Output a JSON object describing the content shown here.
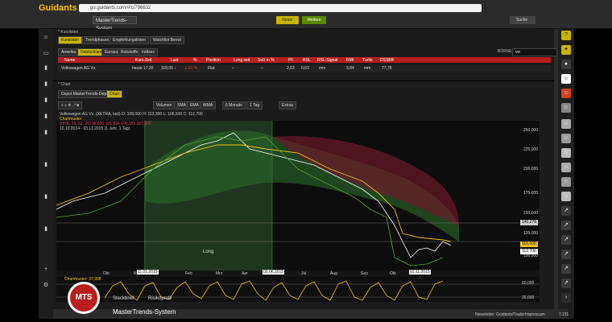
{
  "app": {
    "logo": "Guidants",
    "url": "go.guidants.com/#/c/796632",
    "tab_title": "MasterTrends-System",
    "btn_yellow": "Neuer",
    "btn_green": "Weitere",
    "search_label": "Suche"
  },
  "panel_kurslisten": {
    "title": "* Kurslisten",
    "tabs": [
      "Kurslisten",
      "Trendphasen",
      "Empfehlungslisten",
      "Watchlist Bernd"
    ],
    "region_tabs": [
      "Amerika",
      "Deutschland",
      "Europa",
      "Rohstoffe",
      "Indizes"
    ],
    "search_value": "vw",
    "search_prefix": "BÖRSE",
    "columns": [
      "Name",
      "Kurs-Zeit",
      "Last",
      "%",
      "Position",
      "Long seit",
      "SuV in %",
      "PF",
      "RSL",
      "RSL-Signal",
      "RMI",
      "Turtle",
      "DSSBB"
    ],
    "rows": [
      [
        "Volkswagen AG Vz.",
        "heute 17:20",
        "118,00 ↓",
        "-1,61 %",
        "Flat",
        "–",
        "–",
        "2,63",
        "0,63",
        "mm",
        "3,84",
        "mm",
        "77,75"
      ]
    ]
  },
  "panel_chart": {
    "title": "* Chart",
    "tabs": [
      "Depot MasterTrends-Depot",
      "Chart"
    ],
    "toolbar": [
      "Volumen",
      "SMA",
      "EMA",
      "WMA",
      "6 Monate",
      "1 Tag",
      "Extras"
    ],
    "legend": [
      "Volkswagen AG Vz. (XETRA, last)  O: 108,000  H: 113,300  L: 106,500  C: 112,700",
      "Chartmuster",
      "IHHB, 26, 52, 26)  99,830  105,894  106,181  107,800",
      "10.10.2014 - 03.11.2015 (1 Jahr, 1 Tag)"
    ],
    "x_labels": [
      "Okt",
      "Nov",
      "Jan",
      "Feb",
      "Mrz",
      "Apr",
      "Mai",
      "Jun",
      "Jul",
      "Aug",
      "Sep",
      "Okt"
    ],
    "x_flags": [
      "11.01.2015",
      "02.06.2015",
      "02.11.2015"
    ],
    "y_labels": [
      "250,000",
      "225,000",
      "200,000",
      "175,000",
      "150,000",
      "125,000",
      "100,000"
    ],
    "price_flags": {
      "top": "140,278",
      "current": "110,000",
      "low": "112,700"
    },
    "long_label": "Long",
    "osc_labels": [
      "80,000",
      "20,000"
    ],
    "osc_legend": "Chartmuster: 37,998"
  },
  "footer": {
    "tabs": [
      "Steckbrief",
      "Risikoprofil"
    ],
    "name": "MasterTrends-System",
    "logo_text": "MTS",
    "links": [
      "Newsletter",
      "Guidants/Trader",
      "Impressum"
    ],
    "count": "7.211"
  }
}
